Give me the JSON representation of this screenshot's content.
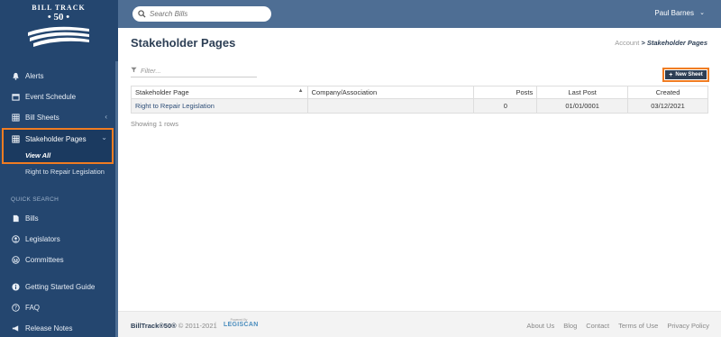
{
  "logo": {
    "line1": "BILL TRACK",
    "line2": "50"
  },
  "sidebar": {
    "items": [
      {
        "name": "sidebar-item-alerts",
        "icon": "bell-icon",
        "label": "Alerts"
      },
      {
        "name": "sidebar-item-event-schedule",
        "icon": "calendar-icon",
        "label": "Event Schedule"
      },
      {
        "name": "sidebar-item-bill-sheets",
        "icon": "grid-icon",
        "label": "Bill Sheets"
      },
      {
        "name": "sidebar-item-stakeholder-pages",
        "icon": "grid-icon",
        "label": "Stakeholder Pages"
      }
    ],
    "sub_active": "View All",
    "sub_link": "Right to Repair Legislation",
    "quick_search_label": "QUICK SEARCH",
    "quick_items": [
      {
        "label": "Bills"
      },
      {
        "label": "Legislators"
      },
      {
        "label": "Committees"
      }
    ],
    "help_items": [
      {
        "label": "Getting Started Guide"
      },
      {
        "label": "FAQ"
      },
      {
        "label": "Release Notes"
      }
    ]
  },
  "topbar": {
    "search_placeholder": "Search Bills",
    "user_name": "Paul Barnes"
  },
  "page": {
    "title": "Stakeholder Pages",
    "breadcrumb_parent": "Account",
    "breadcrumb_sep": ">",
    "breadcrumb_current": "Stakeholder Pages",
    "filter_placeholder": "Filter...",
    "new_sheet_label": "New Sheet"
  },
  "table": {
    "headers": [
      "Stakeholder Page",
      "Company/Association",
      "Posts",
      "Last Post",
      "Created"
    ],
    "rows": [
      [
        "Right to Repair Legislation",
        "",
        "0",
        "01/01/0001",
        "03/12/2021"
      ]
    ],
    "rows_info": "Showing 1 rows"
  },
  "footer": {
    "brand": "BillTrack®50®",
    "copyright": "© 2011-2021",
    "powered_by": "Powered By",
    "legiscan": "LEGISCAN",
    "links": [
      "About Us",
      "Blog",
      "Contact",
      "Terms of Use",
      "Privacy Policy"
    ]
  },
  "colors": {
    "sidebar": "#24466f",
    "topbar": "#4e6e94",
    "highlight": "#f07c22",
    "title": "#2d3f55"
  }
}
